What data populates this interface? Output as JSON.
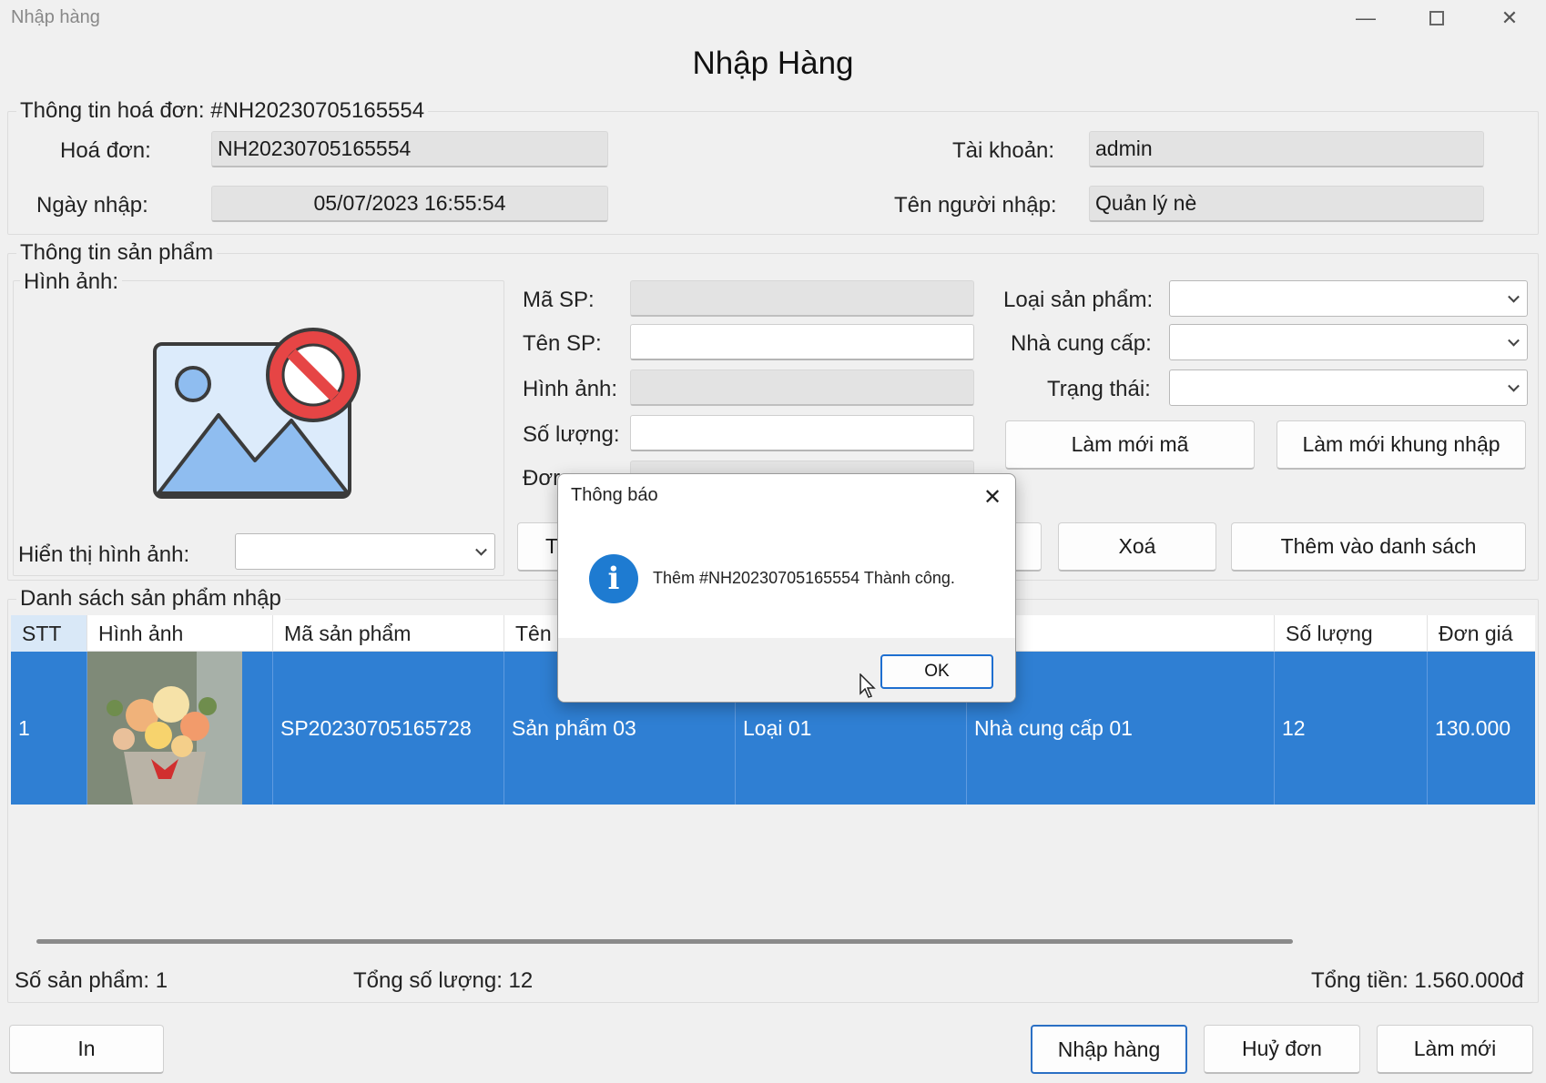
{
  "window": {
    "title": "Nhập hàng",
    "minimize_icon": "minimize-icon",
    "maximize_icon": "maximize-icon",
    "close_icon": "close-icon"
  },
  "form_title": "Nhập Hàng",
  "invoice": {
    "legend": "Thông tin hoá đơn: #NH20230705165554",
    "invoice_label": "Hoá đơn:",
    "invoice_value": "NH20230705165554",
    "date_label": "Ngày nhập:",
    "date_value": "05/07/2023 16:55:54",
    "account_label": "Tài khoản:",
    "account_value": "admin",
    "importer_label": "Tên người nhập:",
    "importer_value": "Quản lý nè"
  },
  "product": {
    "legend": "Thông tin sản phẩm",
    "image_group_legend": "Hình ảnh:",
    "image_placeholder_icon": "no-image-icon",
    "show_image_label": "Hiển thị hình ảnh:",
    "code_label": "Mã SP:",
    "name_label": "Tên SP:",
    "image_label": "Hình ảnh:",
    "qty_label": "Số lượng:",
    "price_label_partial": "Đơr",
    "category_label": "Loại sản phẩm:",
    "supplier_label": "Nhà cung cấp:",
    "status_label": "Trạng thái:",
    "refresh_code_btn": "Làm mới mã",
    "refresh_form_btn": "Làm mới khung nhập",
    "partial_btn": "T",
    "delete_btn": "Xoá",
    "add_to_list_btn": "Thêm vào danh sách"
  },
  "list": {
    "legend": "Danh sách sản phẩm nhập",
    "headers": [
      "STT",
      "Hình ảnh",
      "Mã sản phẩm",
      "Tên",
      "",
      "",
      "Số lượng",
      "Đơn giá"
    ],
    "rows": [
      {
        "stt": "1",
        "image": "flower-basket-photo",
        "code": "SP20230705165728",
        "name": "Sản phẩm 03",
        "category": "Loại 01",
        "supplier": "Nhà cung cấp 01",
        "qty": "12",
        "price": "130.000"
      }
    ]
  },
  "summary": {
    "product_count": "Số sản phẩm: 1",
    "total_qty": "Tổng số lượng: 12",
    "total_money": "Tổng tiền: 1.560.000đ"
  },
  "footer": {
    "print_btn": "In",
    "import_btn": "Nhập hàng",
    "cancel_btn": "Huỷ đơn",
    "refresh_btn": "Làm mới"
  },
  "dialog": {
    "title": "Thông báo",
    "icon": "info-icon",
    "message": "Thêm #NH20230705165554 Thành công.",
    "ok_label": "OK"
  },
  "colors": {
    "selection": "#2f7fd3",
    "accent": "#1e6fd0",
    "info": "#1e7bd1"
  }
}
